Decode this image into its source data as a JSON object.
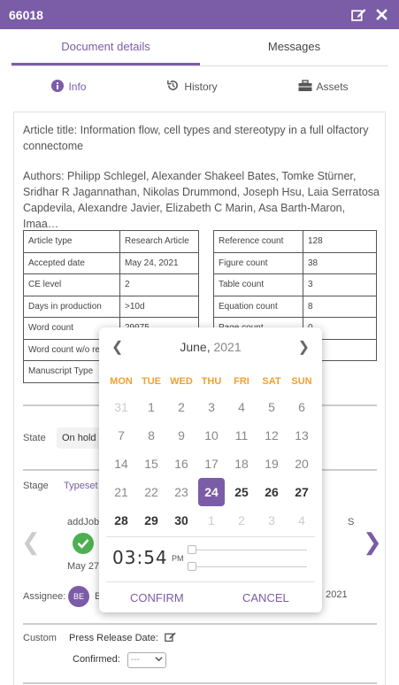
{
  "window": {
    "title": "66018",
    "edit_icon": "edit-icon",
    "close_icon": "close-icon"
  },
  "tabs": [
    {
      "label": "Document details",
      "active": true
    },
    {
      "label": "Messages",
      "active": false
    }
  ],
  "subtabs": [
    {
      "label": "Info",
      "icon": "info-icon",
      "active": true
    },
    {
      "label": "History",
      "icon": "history-icon",
      "active": false
    },
    {
      "label": "Assets",
      "icon": "briefcase-icon",
      "active": false
    }
  ],
  "article": {
    "title": "Article title: Information flow, cell types and stereotypy in a full olfactory connectome",
    "authors": "Authors: Philipp Schlegel, Alexander Shakeel Bates, Tomke Stürner, Sridhar R Jagannathan, Nikolas Drummond, Joseph Hsu, Laia Serratosa Capdevila, Alexandre Javier, Elizabeth C Marin, Asa Barth-Maron, Imaa…"
  },
  "meta_left": [
    {
      "label": "Article type",
      "value": "Research Article"
    },
    {
      "label": "Accepted date",
      "value": "May 24, 2021"
    },
    {
      "label": "CE level",
      "value": "2"
    },
    {
      "label": "Days in production",
      "value": ">10d"
    },
    {
      "label": "Word count",
      "value": "29975"
    },
    {
      "label": "Word count w/o re",
      "value": ""
    },
    {
      "label": "Manuscript Type",
      "value": ""
    }
  ],
  "meta_right": [
    {
      "label": "Reference count",
      "value": "128"
    },
    {
      "label": "Figure count",
      "value": "38"
    },
    {
      "label": "Table count",
      "value": "3"
    },
    {
      "label": "Equation count",
      "value": "8"
    },
    {
      "label": "Page count",
      "value": "0"
    },
    {
      "label": "",
      "value": ""
    }
  ],
  "state": {
    "label": "State",
    "value": "On hold"
  },
  "stage": {
    "label": "Stage",
    "value": "Typeset"
  },
  "workflow": {
    "step_name": "addJob",
    "step_date": "May 27",
    "next_step_partial": "S"
  },
  "assignee": {
    "label": "Assignee:",
    "initials": "BE",
    "name_partial": "B",
    "date_partial": ", 2021"
  },
  "custom": {
    "label": "Custom",
    "press_release_label": "Press Release Date:",
    "confirmed_label": "Confirmed:",
    "confirmed_value": "---"
  },
  "datepicker": {
    "month": "June,",
    "year": "2021",
    "weekdays": [
      "MON",
      "TUE",
      "WED",
      "THU",
      "FRI",
      "SAT",
      "SUN"
    ],
    "days": [
      {
        "n": "31",
        "type": "other"
      },
      {
        "n": "1",
        "type": "past"
      },
      {
        "n": "2",
        "type": "past"
      },
      {
        "n": "3",
        "type": "past"
      },
      {
        "n": "4",
        "type": "past"
      },
      {
        "n": "5",
        "type": "past"
      },
      {
        "n": "6",
        "type": "past"
      },
      {
        "n": "7",
        "type": "past"
      },
      {
        "n": "8",
        "type": "past"
      },
      {
        "n": "9",
        "type": "past"
      },
      {
        "n": "10",
        "type": "past"
      },
      {
        "n": "11",
        "type": "past"
      },
      {
        "n": "12",
        "type": "past"
      },
      {
        "n": "13",
        "type": "past"
      },
      {
        "n": "14",
        "type": "past"
      },
      {
        "n": "15",
        "type": "past"
      },
      {
        "n": "16",
        "type": "past"
      },
      {
        "n": "17",
        "type": "past"
      },
      {
        "n": "18",
        "type": "past"
      },
      {
        "n": "19",
        "type": "past"
      },
      {
        "n": "20",
        "type": "past"
      },
      {
        "n": "21",
        "type": "past"
      },
      {
        "n": "22",
        "type": "past"
      },
      {
        "n": "23",
        "type": "past"
      },
      {
        "n": "24",
        "type": "selected"
      },
      {
        "n": "25",
        "type": "future"
      },
      {
        "n": "26",
        "type": "future"
      },
      {
        "n": "27",
        "type": "future"
      },
      {
        "n": "28",
        "type": "future"
      },
      {
        "n": "29",
        "type": "future"
      },
      {
        "n": "30",
        "type": "future"
      },
      {
        "n": "1",
        "type": "other"
      },
      {
        "n": "2",
        "type": "other"
      },
      {
        "n": "3",
        "type": "other"
      },
      {
        "n": "4",
        "type": "other"
      }
    ],
    "time": "03:54",
    "ampm": "PM",
    "hour_level": 0,
    "minute_level": 0,
    "confirm_label": "CONFIRM",
    "cancel_label": "CANCEL"
  }
}
